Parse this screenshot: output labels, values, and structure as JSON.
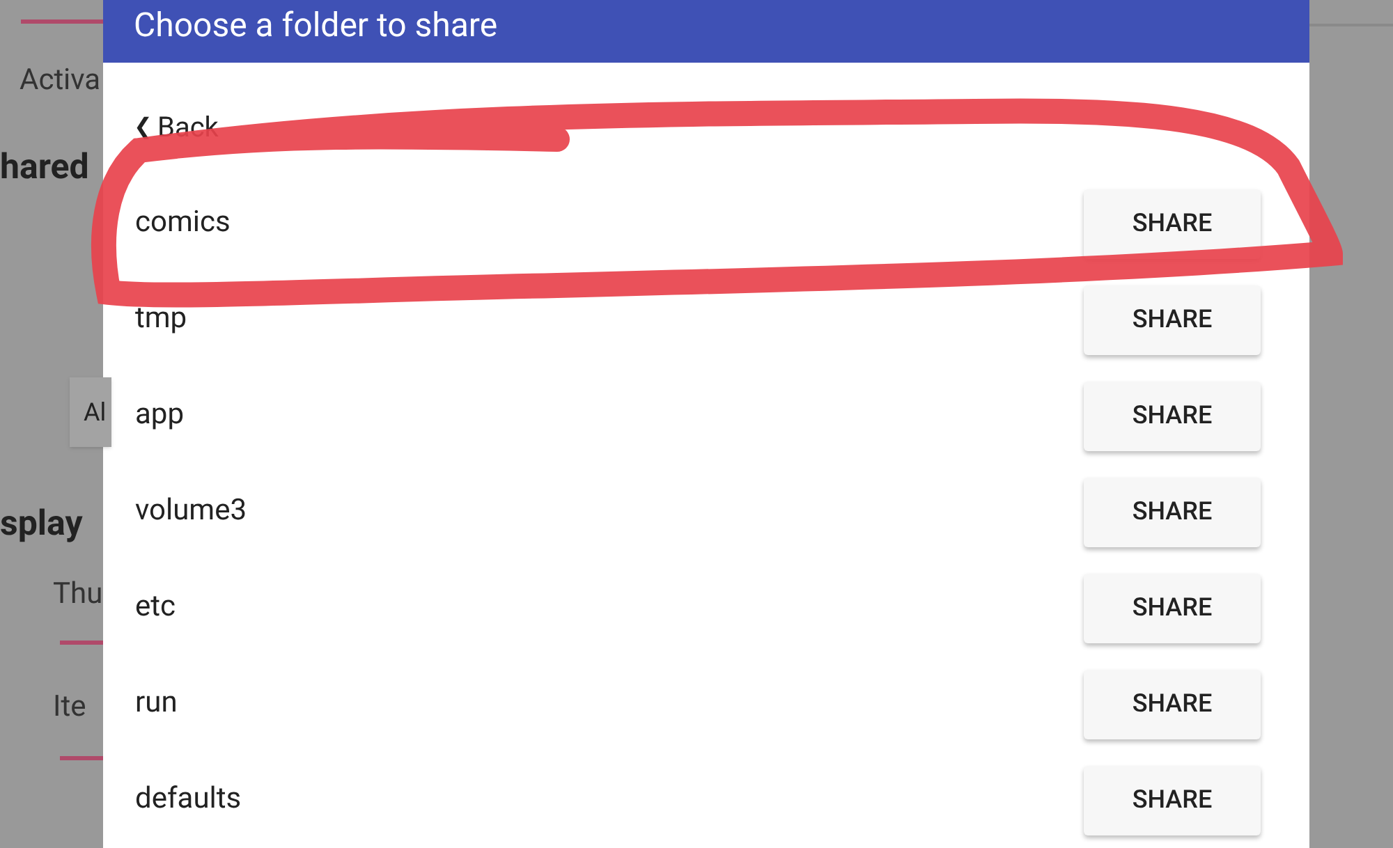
{
  "background": {
    "texts": [
      {
        "kind": "label",
        "text": "Activa"
      },
      {
        "kind": "heading",
        "text": "hared"
      },
      {
        "kind": "button",
        "text": "Al"
      },
      {
        "kind": "heading",
        "text": "splay"
      },
      {
        "kind": "label",
        "text": "Thu"
      },
      {
        "kind": "label",
        "text": "Ite"
      }
    ]
  },
  "dialog": {
    "title": "Choose a folder to share",
    "back": {
      "icon": "❮",
      "label": "Back"
    },
    "folders": [
      {
        "name": "comics",
        "button": "SHARE"
      },
      {
        "name": "tmp",
        "button": "SHARE"
      },
      {
        "name": "app",
        "button": "SHARE"
      },
      {
        "name": "volume3",
        "button": "SHARE"
      },
      {
        "name": "etc",
        "button": "SHARE"
      },
      {
        "name": "run",
        "button": "SHARE"
      },
      {
        "name": "defaults",
        "button": "SHARE"
      }
    ]
  }
}
